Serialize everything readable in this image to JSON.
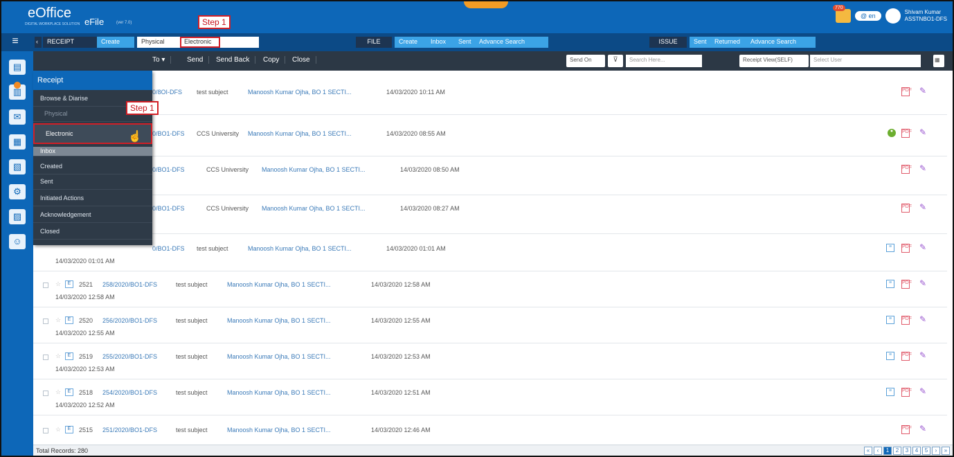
{
  "header": {
    "logo": "eOffice",
    "logo_sub": "DIGITAL WORKPLACE SOLUTION",
    "efile": "eFile",
    "version": "(ver 7.0)",
    "notif_count": "770",
    "lang": "@ en",
    "user_name": "Shivam Kumar",
    "user_role": "ASSTNBO1-DFS"
  },
  "steps": {
    "top": "Step 1",
    "side": "Step 1"
  },
  "nav": {
    "receipt": "RECEIPT",
    "create": "Create",
    "physical": "Physical",
    "electronic": "Electronic",
    "file": "FILE",
    "file_create": "Create",
    "file_inbox": "Inbox",
    "file_sent": "Sent",
    "file_adv": "Advance Search",
    "issue": "ISSUE",
    "issue_sent": "Sent",
    "issue_returned": "Returned",
    "issue_adv": "Advance Search"
  },
  "toolbar": {
    "send_to": "To ▾",
    "send": "Send",
    "send_back": "Send Back",
    "copy": "Copy",
    "close": "Close",
    "send_on": "Send On",
    "search_ph": "Search Here...",
    "view": "Receipt View(SELF)",
    "select_user": "Select User"
  },
  "dropdown": {
    "title": "Receipt",
    "items": [
      "Browse & Diarise",
      "Physical",
      "Electronic",
      "Inbox",
      "Created",
      "Sent",
      "Initiated Actions",
      "Acknowledgement",
      "Closed"
    ]
  },
  "rows": [
    {
      "fno": "0/8OI-DFS",
      "subj": "test subject",
      "from": "Manoosh Kumar Ojha, BO 1 SECTI...",
      "dt": "14/03/2020 10:11 AM",
      "sub": ""
    },
    {
      "fno": "0/BO1-DFS",
      "subj": "CCS University",
      "from": "Manoosh Kumar Ojha, BO 1 SECTI...",
      "dt": "14/03/2020 08:55 AM",
      "sub": ""
    },
    {
      "fno": "0/BO1-DFS",
      "subj": "CCS University",
      "from": "Manoosh Kumar Ojha, BO 1 SECTI...",
      "dt": "14/03/2020 08:50 AM",
      "sub": ""
    },
    {
      "fno": "0/BO1-DFS",
      "subj": "CCS University",
      "from": "Manoosh Kumar Ojha, BO 1 SECTI...",
      "dt": "14/03/2020 08:27 AM",
      "sub": ""
    },
    {
      "fno": "0/BO1-DFS",
      "subj": "test subject",
      "from": "Manoosh Kumar Ojha, BO 1 SECTI...",
      "dt": "14/03/2020 01:01 AM",
      "sub": "14/03/2020 01:01 AM"
    },
    {
      "rno": "2521",
      "fno": "258/2020/BO1-DFS",
      "subj": "test subject",
      "from": "Manoosh Kumar Ojha, BO 1 SECTI...",
      "dt": "14/03/2020 12:58 AM",
      "sub": "14/03/2020 12:58 AM"
    },
    {
      "rno": "2520",
      "fno": "256/2020/BO1-DFS",
      "subj": "test subject",
      "from": "Manoosh Kumar Ojha, BO 1 SECTI...",
      "dt": "14/03/2020 12:55 AM",
      "sub": "14/03/2020 12:55 AM"
    },
    {
      "rno": "2519",
      "fno": "255/2020/BO1-DFS",
      "subj": "test subject",
      "from": "Manoosh Kumar Ojha, BO 1 SECTI...",
      "dt": "14/03/2020 12:53 AM",
      "sub": "14/03/2020 12:53 AM"
    },
    {
      "rno": "2518",
      "fno": "254/2020/BO1-DFS",
      "subj": "test subject",
      "from": "Manoosh Kumar Ojha, BO 1 SECTI...",
      "dt": "14/03/2020 12:51 AM",
      "sub": "14/03/2020 12:52 AM"
    },
    {
      "rno": "2515",
      "fno": "251/2020/BO1-DFS",
      "subj": "test subject",
      "from": "Manoosh Kumar Ojha, BO 1 SECTI...",
      "dt": "14/03/2020 12:46 AM",
      "sub": ""
    }
  ],
  "footer": {
    "total": "Total Records: 280",
    "pages": [
      "1",
      "2",
      "3",
      "4",
      "5"
    ]
  }
}
